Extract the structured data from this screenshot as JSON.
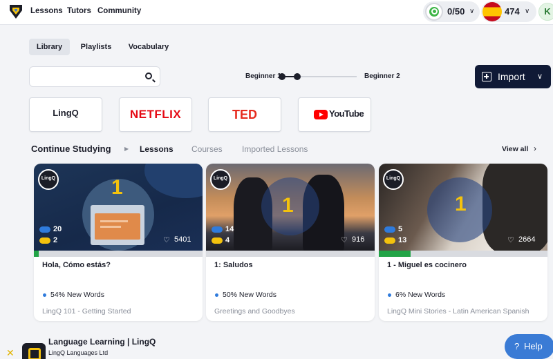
{
  "nav": {
    "lessons": "Lessons",
    "tutors": "Tutors",
    "community": "Community"
  },
  "streak": {
    "value": "0/50",
    "color": "#3fb548",
    "icon": "coin-icon"
  },
  "language": {
    "count": "474",
    "flag": "spain-flag-icon"
  },
  "avatar_letter": "K",
  "library_tabs": [
    "Library",
    "Playlists",
    "Vocabulary"
  ],
  "search": {
    "placeholder": "",
    "value": ""
  },
  "level": {
    "start": "Beginner 1",
    "end": "Beginner 2"
  },
  "import": {
    "label": "Import"
  },
  "providers": {
    "lingq": "LingQ",
    "netflix": "NETFLIX",
    "ted": "TED",
    "youtube": "YouTube"
  },
  "continue": {
    "title": "Continue Studying",
    "tabs": [
      "Lessons",
      "Courses",
      "Imported Lessons"
    ],
    "view_all": "View all"
  },
  "cards": [
    {
      "badge": "LingQ",
      "level": "1",
      "blue": "20",
      "yellow": "2",
      "likes": "5401",
      "progress": 0.03,
      "title": "Hola, Cómo estás?",
      "new_words": "54% New Words",
      "course": "LingQ 101 - Getting Started"
    },
    {
      "badge": "LingQ",
      "level": "1",
      "blue": "14",
      "yellow": "4",
      "likes": "916",
      "progress": 0.0,
      "title": "1: Saludos",
      "new_words": "50% New Words",
      "course": "Greetings and Goodbyes"
    },
    {
      "badge": "LingQ",
      "level": "1",
      "blue": "5",
      "yellow": "13",
      "likes": "2664",
      "progress": 0.19,
      "title": "1 - Miguel es cocinero",
      "new_words": "6% New Words",
      "course": "LingQ Mini Stories - Latin American Spanish"
    }
  ],
  "colors": {
    "blue_pill": "#2f7bdc",
    "yellow_pill": "#f4c20d",
    "progress": "#22a447",
    "import_bg": "#101a36",
    "help_bg": "#3a7bd5"
  },
  "banner": {
    "title": "Language Learning | LingQ",
    "subtitle": "LingQ Languages Ltd"
  },
  "help": {
    "label": "Help"
  }
}
